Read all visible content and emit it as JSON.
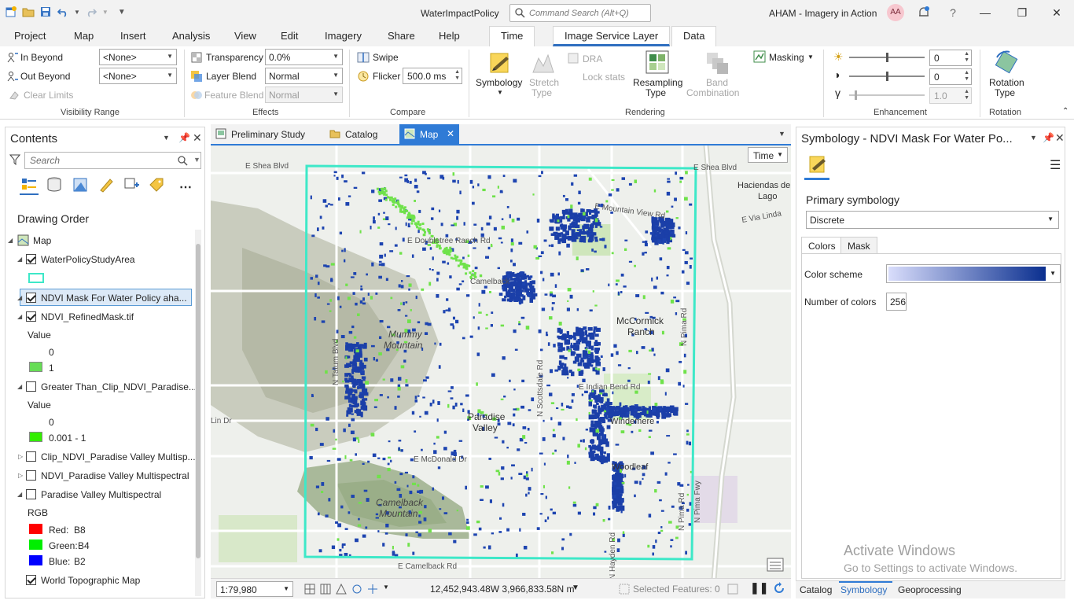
{
  "title_bar": {
    "project_name": "WaterImpactPolicy",
    "search_placeholder": "Command Search (Alt+Q)",
    "account": "AHAM - Imagery in Action",
    "avatar_initials": "AA",
    "help": "?"
  },
  "ribbon_tabs": [
    "Project",
    "Map",
    "Insert",
    "Analysis",
    "View",
    "Edit",
    "Imagery",
    "Share",
    "Help"
  ],
  "context_tabs": [
    "Time",
    "Image Service Layer",
    "Data"
  ],
  "ribbon": {
    "visibility_range": {
      "in_beyond": "In Beyond",
      "out_beyond": "Out Beyond",
      "clear_limits": "Clear Limits",
      "in_value": "<None>",
      "out_value": "<None>",
      "label": "Visibility Range"
    },
    "effects": {
      "transparency": "Transparency",
      "transparency_value": "0.0%",
      "layer_blend": "Layer Blend",
      "layer_blend_value": "Normal",
      "feature_blend": "Feature Blend",
      "feature_blend_value": "Normal",
      "label": "Effects"
    },
    "compare": {
      "swipe": "Swipe",
      "flicker": "Flicker",
      "flicker_value": "500.0",
      "flicker_unit": "ms",
      "label": "Compare"
    },
    "rendering": {
      "symbology": "Symbology",
      "stretch": "Stretch",
      "stretch_type": "Type",
      "dra": "DRA",
      "lock_stats": "Lock stats",
      "resampling": "Resampling",
      "resampling_type": "Type",
      "band": "Band",
      "band_combination": "Combination",
      "masking": "Masking",
      "label": "Rendering"
    },
    "enhancement": {
      "brightness": "0",
      "contrast": "0",
      "gamma": "1.0",
      "label": "Enhancement"
    },
    "rotation": {
      "rotation": "Rotation",
      "rotation_type": "Type",
      "label": "Rotation"
    }
  },
  "contents": {
    "title": "Contents",
    "search_placeholder": "Search",
    "drawing_order": "Drawing Order",
    "map": "Map",
    "layers": {
      "water_policy": "WaterPolicyStudyArea",
      "ndvi_mask": "NDVI Mask For Water Policy aha...",
      "ndvi_refined": "NDVI_RefinedMask.tif",
      "value_label_1": "Value",
      "value_0_a": "0",
      "value_1_a": "1",
      "greater_than": "Greater Than_Clip_NDVI_Paradise...",
      "value_label_2": "Value",
      "value_0_b": "0",
      "value_range_b": "0.001 - 1",
      "clip_ndvi": "Clip_NDVI_Paradise Valley Multisp...",
      "ndvi_pv": "NDVI_Paradise Valley Multispectral",
      "pv_multispectral": "Paradise Valley Multispectral",
      "rgb": "RGB",
      "red": "Red:",
      "red_band": "B8",
      "green": "Green:",
      "green_band": "B4",
      "blue": "Blue:",
      "blue_band": "B2",
      "topo": "World Topographic Map"
    },
    "colors": {
      "study_area": "#3ee8c8",
      "refined_1": "#66dd55",
      "gt_range": "#33ee00",
      "red": "#ff0000",
      "green": "#00ee00",
      "blue": "#0000ff"
    }
  },
  "view_tabs": [
    "Preliminary Study",
    "Catalog",
    "Map"
  ],
  "map": {
    "time_button": "Time",
    "labels": {
      "shea_w": "E Shea Blvd",
      "shea_e": "E Shea Blvd",
      "haciendas_1": "Haciendas de",
      "haciendas_2": "Lago",
      "mountain_view": "E Mountain View Rd",
      "via_linda": "E Via Linda",
      "doubletree": "E Doubletree Ranch Rd",
      "camelback_small": "Camelback",
      "mummy_1": "Mummy",
      "mummy_2": "Mountain",
      "mccormick_1": "McCormick",
      "mccormick_2": "Ranch",
      "pima": "N Pima Rd",
      "tatum": "N Tatum Blvd",
      "scottsdale": "N Scottsdale Rd",
      "indian_bend": "E Indian Bend Rd",
      "windemere": "Windemere",
      "paradise_1": "Paradise",
      "paradise_2": "Valley",
      "lin_dr": "Lin Dr",
      "mcdonald": "E McDonald Dr",
      "woodleaf": "Woodleaf",
      "camelback_mtn_1": "Camelback",
      "camelback_mtn_2": "Mountain",
      "pima_fwy": "N Pima Fwy",
      "hayden": "N Hayden Rd",
      "camelback_rd": "E Camelback Rd",
      "pima_2": "N Pima Rd"
    }
  },
  "status_bar": {
    "scale": "1:79,980",
    "coords": "12,452,943.48W 3,966,833.58N m",
    "selected_features": "Selected Features: 0"
  },
  "symbology": {
    "title": "Symbology - NDVI Mask For Water Po...",
    "primary_symbology": "Primary symbology",
    "renderer": "Discrete",
    "tabs": [
      "Colors",
      "Mask"
    ],
    "color_scheme_label": "Color scheme",
    "number_of_colors_label": "Number of colors",
    "number_of_colors": "256"
  },
  "watermark": {
    "line1": "Activate Windows",
    "line2": "Go to Settings to activate Windows."
  },
  "bottom_tabs": [
    "Catalog",
    "Symbology",
    "Geoprocessing"
  ]
}
